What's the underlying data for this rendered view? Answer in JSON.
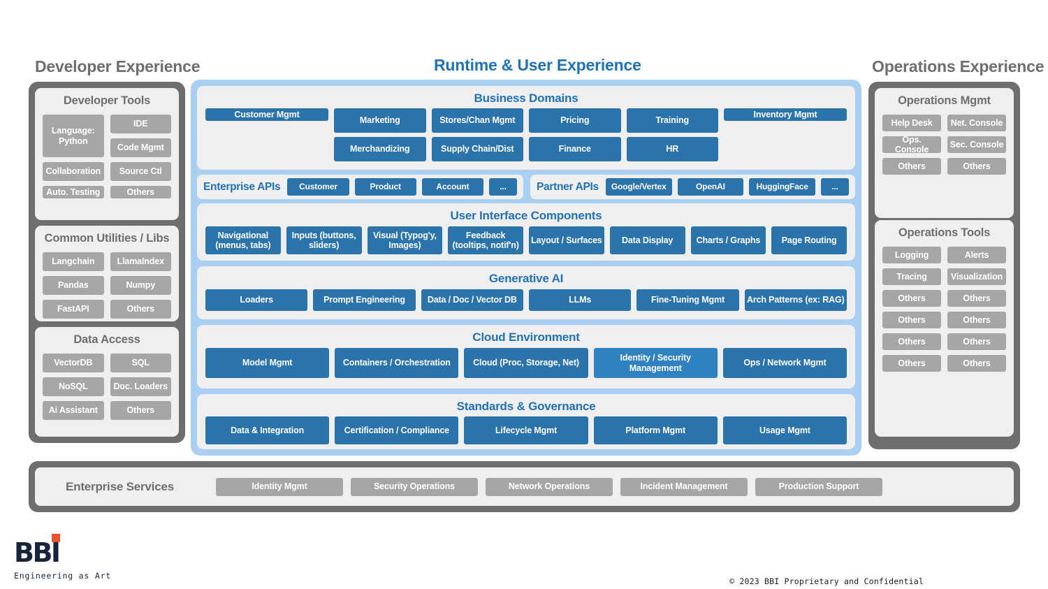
{
  "headers": {
    "developer": "Developer Experience",
    "runtime": "Runtime & User Experience",
    "operations": "Operations Experience"
  },
  "colors": {
    "blue_accent": "#2171b5",
    "chip_blue": "#2b74ab",
    "chip_gray": "#a6a6a6",
    "frame_gray": "#6e6e6e",
    "frame_blue": "#a9d0f2",
    "card_bg": "#efefef",
    "logo_navy": "#16243c",
    "logo_orange": "#e8542c"
  },
  "developer": {
    "tools": {
      "title": "Developer Tools",
      "items": [
        "Language: Python",
        "IDE",
        "Code Mgmt",
        "Collaboration",
        "Source Ctl",
        "Auto. Testing",
        "Others"
      ]
    },
    "utilities": {
      "title": "Common Utilities / Libs",
      "items": [
        "Langchain",
        "LlamaIndex",
        "Pandas",
        "Numpy",
        "FastAPI",
        "Others"
      ]
    },
    "data_access": {
      "title": "Data Access",
      "items": [
        "VectorDB",
        "SQL",
        "NoSQL",
        "Doc. Loaders",
        "Ai Assistant",
        "Others"
      ]
    }
  },
  "operations": {
    "mgmt": {
      "title": "Operations Mgmt",
      "items": [
        "Help Desk",
        "Net. Console",
        "Ops. Console",
        "Sec. Console",
        "Others",
        "Others"
      ]
    },
    "tools": {
      "title": "Operations Tools",
      "items": [
        "Logging",
        "Alerts",
        "Tracing",
        "Visualization",
        "Others",
        "Others",
        "Others",
        "Others",
        "Others",
        "Others",
        "Others",
        "Others"
      ]
    }
  },
  "runtime": {
    "business_domains": {
      "title": "Business Domains",
      "lead": "Customer Mgmt",
      "pairs": [
        [
          "Marketing",
          "Merchandizing"
        ],
        [
          "Stores/Chan Mgmt",
          "Supply Chain/Dist"
        ],
        [
          "Pricing",
          "Finance"
        ],
        [
          "Training",
          "HR"
        ]
      ],
      "trail": "Inventory Mgmt"
    },
    "enterprise_apis": {
      "label": "Enterprise APIs",
      "items": [
        "Customer",
        "Product",
        "Account",
        "..."
      ]
    },
    "partner_apis": {
      "label": "Partner APIs",
      "items": [
        "Google/Vertex",
        "OpenAI",
        "HuggingFace",
        "..."
      ]
    },
    "ui_components": {
      "title": "User Interface Components",
      "items": [
        "Navigational (menus, tabs)",
        "Inputs (buttons, sliders)",
        "Visual (Typog'y, Images)",
        "Feedback (tooltips, notif'n)",
        "Layout / Surfaces",
        "Data Display",
        "Charts / Graphs",
        "Page Routing"
      ]
    },
    "generative_ai": {
      "title": "Generative AI",
      "items": [
        "Loaders",
        "Prompt Engineering",
        "Data / Doc / Vector DB",
        "LLMs",
        "Fine-Tuning Mgmt",
        "Arch Patterns (ex: RAG)"
      ]
    },
    "cloud_environment": {
      "title": "Cloud Environment",
      "items": [
        "Model Mgmt",
        "Containers / Orchestration",
        "Cloud (Proc, Storage, Net)",
        "Identity / Security Management",
        "Ops / Network Mgmt"
      ]
    },
    "standards_governance": {
      "title": "Standards & Governance",
      "items": [
        "Data & Integration",
        "Certification / Compliance",
        "Lifecycle Mgmt",
        "Platform Mgmt",
        "Usage Mgmt"
      ]
    }
  },
  "enterprise_services": {
    "title": "Enterprise Services",
    "items": [
      "Identity Mgmt",
      "Security Operations",
      "Network Operations",
      "Incident Management",
      "Production Support"
    ]
  },
  "footer": {
    "logo_word": "BBI",
    "logo_tagline": "Engineering as Art",
    "copyright": "© 2023 BBI Proprietary and Confidential"
  }
}
